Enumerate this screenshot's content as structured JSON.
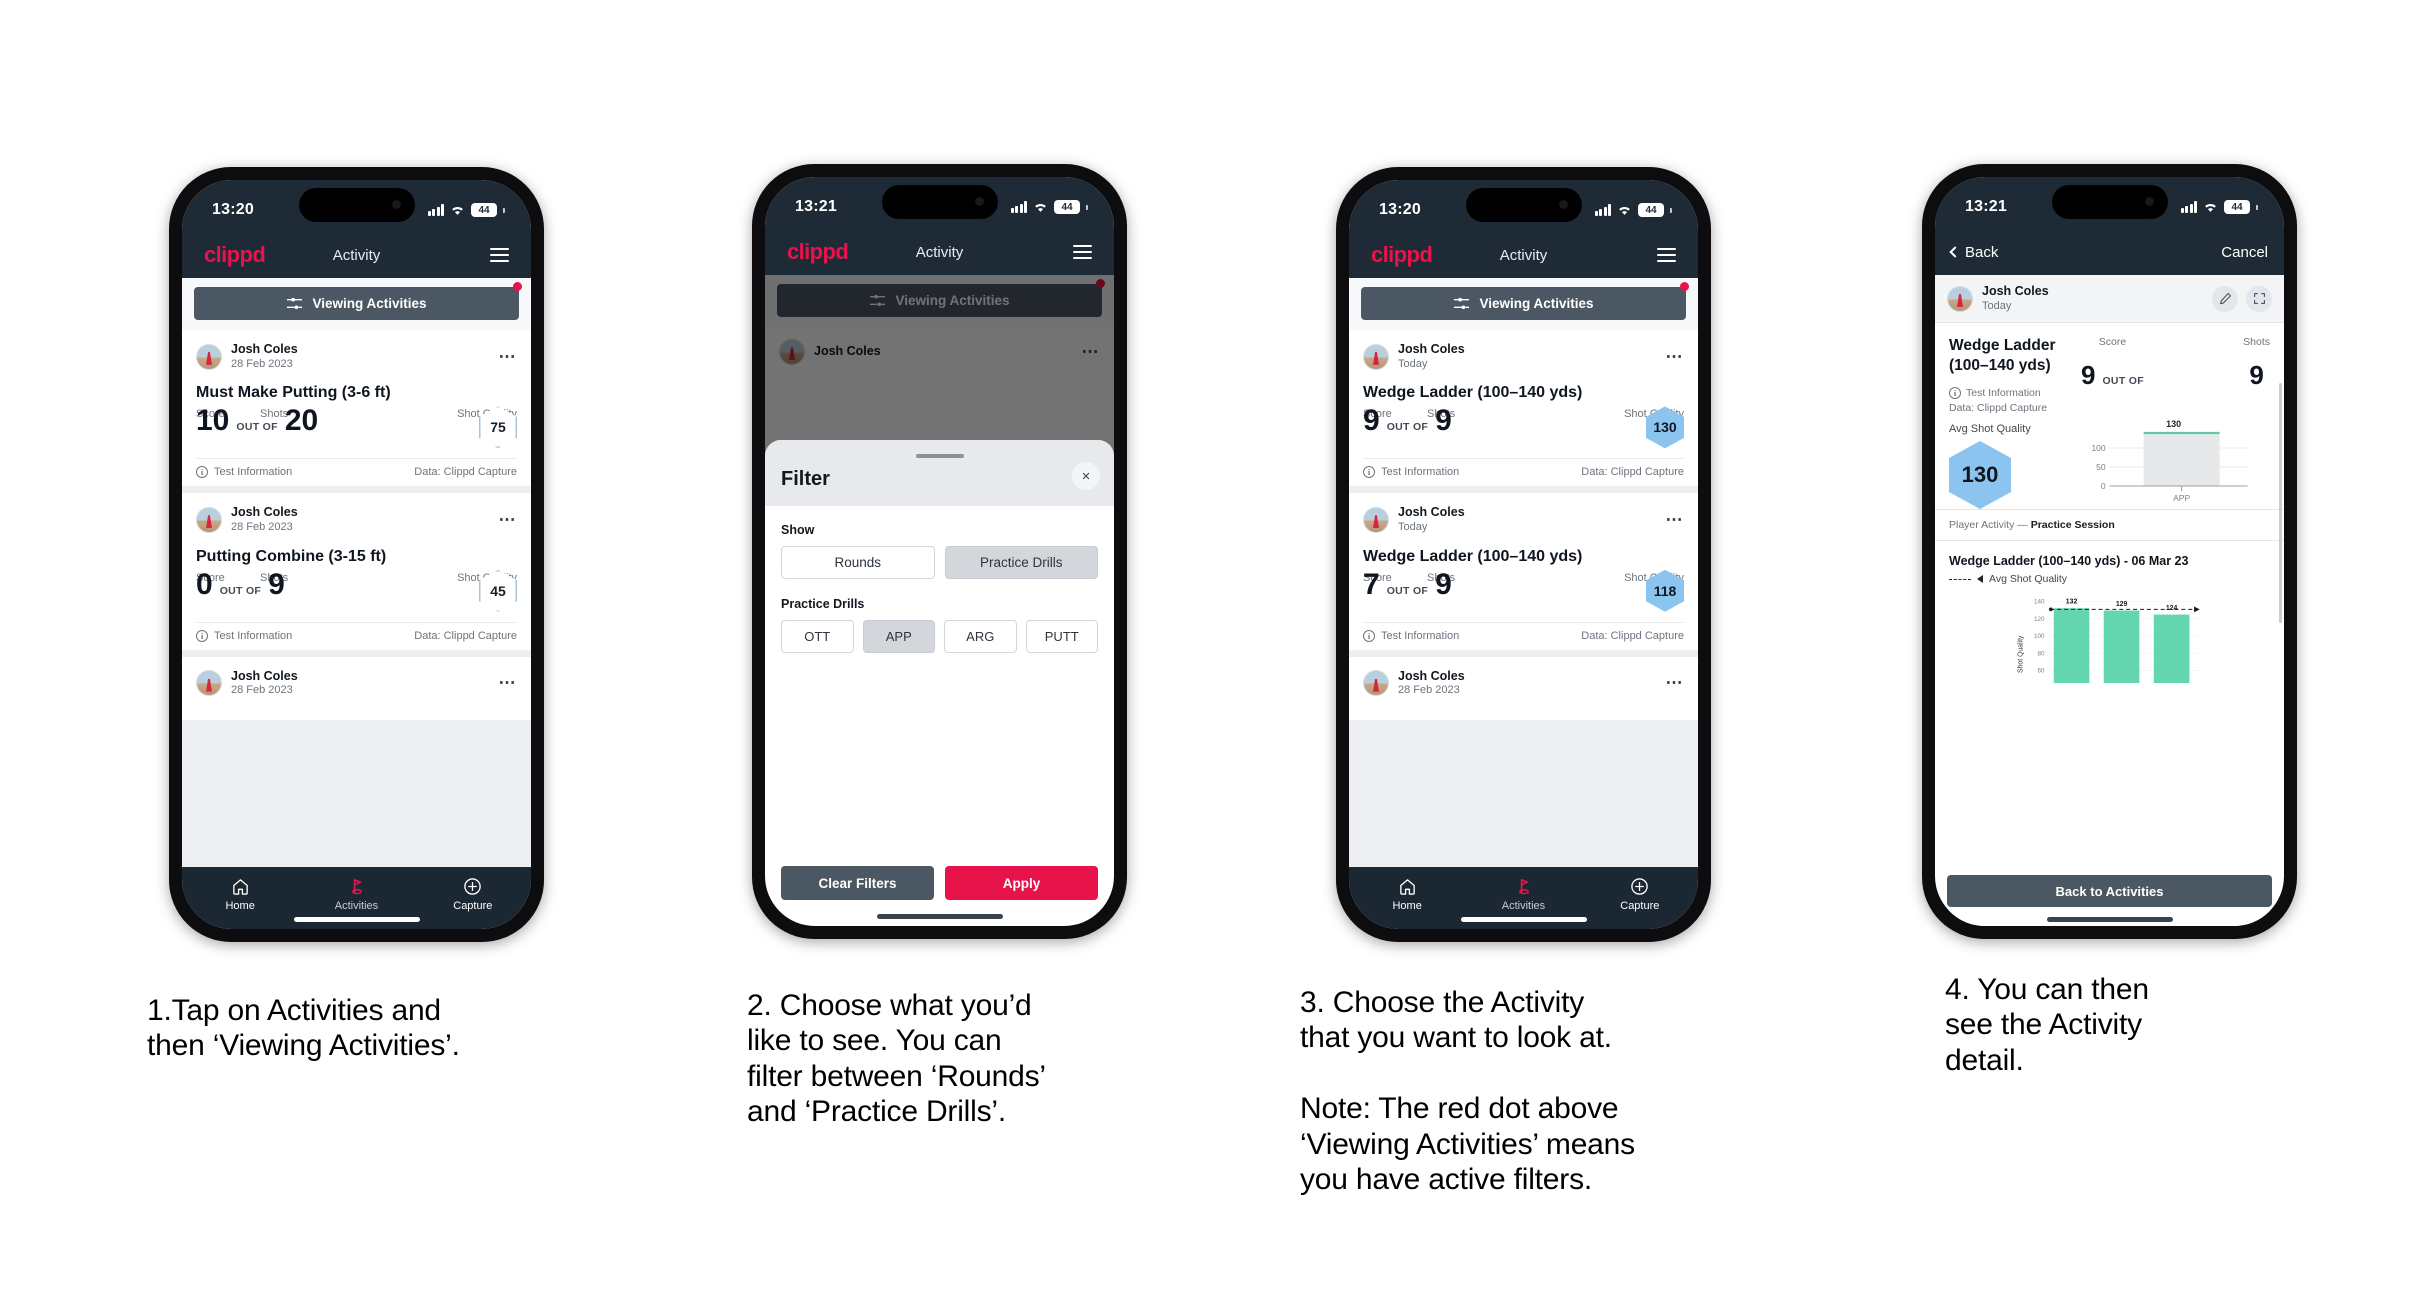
{
  "phones": [
    {
      "id": "phone-1",
      "status": {
        "time": "13:20",
        "battery": "44"
      },
      "appbar": {
        "logo": "clippd",
        "title": "Activity"
      },
      "filter_button": {
        "label": "Viewing Activities",
        "has_red_dot": true
      },
      "cards": [
        {
          "user": "Josh Coles",
          "date": "28 Feb 2023",
          "title": "Must Make Putting (3-6 ft)",
          "score_label": "Score",
          "shots_label": "Shots",
          "quality_label": "Shot Quality",
          "score": "10",
          "out_of": "OUT OF",
          "shots": "20",
          "quality": "75",
          "quality_style": "outline",
          "foot_left": "Test Information",
          "foot_right": "Data: Clippd Capture"
        },
        {
          "user": "Josh Coles",
          "date": "28 Feb 2023",
          "title": "Putting Combine (3-15 ft)",
          "score_label": "Score",
          "shots_label": "Shots",
          "quality_label": "Shot Quality",
          "score": "0",
          "out_of": "OUT OF",
          "shots": "9",
          "quality": "45",
          "quality_style": "outline",
          "foot_left": "Test Information",
          "foot_right": "Data: Clippd Capture"
        },
        {
          "user": "Josh Coles",
          "date": "28 Feb 2023",
          "partial": true
        }
      ],
      "tabs": [
        {
          "label": "Home",
          "icon": "home-icon",
          "active": false
        },
        {
          "label": "Activities",
          "icon": "golf-flag-icon",
          "active": true
        },
        {
          "label": "Capture",
          "icon": "plus-circle-icon",
          "active": false
        }
      ]
    },
    {
      "id": "phone-2",
      "status": {
        "time": "13:21",
        "battery": "44"
      },
      "appbar": {
        "logo": "clippd",
        "title": "Activity"
      },
      "filter_button": {
        "label": "Viewing Activities",
        "has_red_dot": true
      },
      "behind_card_user": "Josh Coles",
      "sheet": {
        "title": "Filter",
        "close_label": "×",
        "show_label": "Show",
        "show_options": [
          {
            "label": "Rounds",
            "selected": false
          },
          {
            "label": "Practice Drills",
            "selected": true
          }
        ],
        "drills_label": "Practice Drills",
        "drill_options": [
          {
            "label": "OTT",
            "selected": false
          },
          {
            "label": "APP",
            "selected": true
          },
          {
            "label": "ARG",
            "selected": false
          },
          {
            "label": "PUTT",
            "selected": false
          }
        ],
        "clear_label": "Clear Filters",
        "apply_label": "Apply"
      }
    },
    {
      "id": "phone-3",
      "status": {
        "time": "13:20",
        "battery": "44"
      },
      "appbar": {
        "logo": "clippd",
        "title": "Activity"
      },
      "filter_button": {
        "label": "Viewing Activities",
        "has_red_dot": true
      },
      "cards": [
        {
          "user": "Josh Coles",
          "date": "Today",
          "title": "Wedge Ladder (100–140 yds)",
          "score_label": "Score",
          "shots_label": "Shots",
          "quality_label": "Shot Quality",
          "score": "9",
          "out_of": "OUT OF",
          "shots": "9",
          "quality": "130",
          "quality_style": "fill",
          "foot_left": "Test Information",
          "foot_right": "Data: Clippd Capture"
        },
        {
          "user": "Josh Coles",
          "date": "Today",
          "title": "Wedge Ladder (100–140 yds)",
          "score_label": "Score",
          "shots_label": "Shots",
          "quality_label": "Shot Quality",
          "score": "7",
          "out_of": "OUT OF",
          "shots": "9",
          "quality": "118",
          "quality_style": "fill",
          "foot_left": "Test Information",
          "foot_right": "Data: Clippd Capture"
        },
        {
          "user": "Josh Coles",
          "date": "28 Feb 2023",
          "partial": true
        }
      ],
      "tabs": [
        {
          "label": "Home",
          "icon": "home-icon",
          "active": false
        },
        {
          "label": "Activities",
          "icon": "golf-flag-icon",
          "active": true
        },
        {
          "label": "Capture",
          "icon": "plus-circle-icon",
          "active": false
        }
      ]
    },
    {
      "id": "phone-4",
      "status": {
        "time": "13:21",
        "battery": "44"
      },
      "navbar": {
        "back": "Back",
        "cancel": "Cancel"
      },
      "detail": {
        "user": "Josh Coles",
        "date": "Today",
        "title": "Wedge Ladder\n(100–140 yds)",
        "score_label": "Score",
        "shots_label": "Shots",
        "score": "9",
        "out_of": "OUT OF",
        "shots": "9",
        "info_label": "Test Information",
        "data_label": "Data: Clippd Capture",
        "avg_label": "Avg Shot Quality",
        "avg_value": "130",
        "section_prefix": "Player Activity — ",
        "section_bold": "Practice Session",
        "chart_title": "Wedge Ladder (100–140 yds) - 06 Mar 23",
        "legend_label": "Avg Shot Quality",
        "back_to_activities": "Back to Activities"
      }
    }
  ],
  "captions": [
    "1.Tap on Activities and\nthen ‘Viewing Activities’.",
    "2. Choose what you’d\nlike to see. You can\nfilter between ‘Rounds’\nand ‘Practice Drills’.",
    "3. Choose the Activity\nthat you want to look at.\n\nNote: The red dot above\n‘Viewing Activities’ means\nyou have active filters.",
    "4. You can then\nsee the Activity\ndetail."
  ],
  "chart_data": [
    {
      "type": "bar",
      "id": "mini-app-chart",
      "categories": [
        "APP"
      ],
      "values": [
        130
      ],
      "data_labels": [
        "130"
      ],
      "ytick_labels": [
        "100",
        "50",
        "0"
      ],
      "ytick_values": [
        100,
        50,
        0
      ],
      "xlabel": "",
      "ylabel": "",
      "ylim": [
        0,
        145
      ],
      "title": "",
      "grid": true,
      "legend": "none",
      "bar_color": "#e6e8ea",
      "cap_color": "#63c6a8"
    },
    {
      "type": "bar",
      "id": "shot-quality-chart",
      "title": "Wedge Ladder (100–140 yds) - 06 Mar 23",
      "series": [
        {
          "name": "Shot Quality",
          "values": [
            132,
            129,
            124
          ]
        }
      ],
      "data_labels": [
        "132",
        "129",
        "124"
      ],
      "categories": [
        "",
        "",
        ""
      ],
      "reference_line": {
        "name": "Avg Shot Quality",
        "value": 130,
        "style": "dashed"
      },
      "ylabel": "Shot Quality",
      "ytick_labels": [
        "140",
        "120",
        "100",
        "80",
        "60"
      ],
      "ytick_values": [
        140,
        120,
        100,
        80,
        60
      ],
      "ylim": [
        50,
        145
      ],
      "grid": true,
      "bar_color": "#63d6b0",
      "legend": "top-left"
    }
  ],
  "colors": {
    "brand_red": "#e8134b",
    "header_navy": "#1e2b37",
    "filter_grey": "#4b5863",
    "hex_blue": "#8cc4f0",
    "bar_green": "#63d6b0"
  }
}
